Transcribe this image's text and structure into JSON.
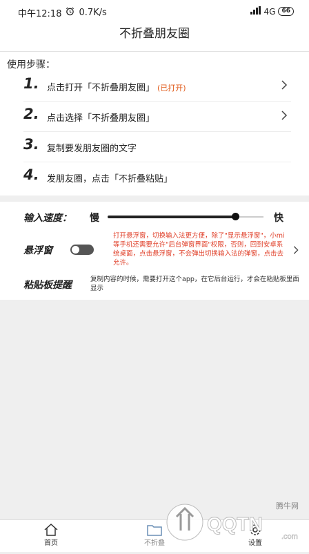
{
  "status_bar": {
    "time": "中午12:18",
    "alarm_icon": "alarm-clock-icon",
    "speed": "0.7K/s",
    "network": "4G",
    "battery": "66"
  },
  "header": {
    "title": "不折叠朋友圈"
  },
  "steps": {
    "heading": "使用步骤：",
    "items": [
      {
        "num": "1.",
        "text": "点击打开「不折叠朋友圈」",
        "tag": "(已打开)",
        "chevron": true
      },
      {
        "num": "2.",
        "text": "点击选择「不折叠朋友圈」",
        "tag": "",
        "chevron": true
      },
      {
        "num": "3.",
        "text": "复制要发朋友圈的文字",
        "tag": "",
        "chevron": false
      },
      {
        "num": "4.",
        "text": "发朋友圈，点击「不折叠粘贴」",
        "tag": "",
        "chevron": false
      }
    ]
  },
  "settings": {
    "speed_label": "输入速度：",
    "slow_label": "慢",
    "fast_label": "快",
    "speed_level": 0.82,
    "float_label": "悬浮窗",
    "float_enabled": false,
    "float_note": "打开悬浮窗，切换输入法更方便，除了\"显示悬浮窗\"，小mi等手机还需要允许\"后台弹窗界面\"权限，否则，回到安卓系统桌面，点击悬浮窗，不会弹出切换输入法的弹窗，点击去允许。",
    "clip_label": "粘贴板提醒",
    "clip_note": "复制内容的时候，需要打开这个app，在它后台运行，才会在粘贴板里面显示"
  },
  "tabs": [
    {
      "label": "首页",
      "icon": "home-icon"
    },
    {
      "label": "不折叠",
      "icon": "folder-icon"
    },
    {
      "label": "设置",
      "icon": "gear-icon"
    }
  ],
  "watermark": {
    "text": "QQTN.com",
    "site": "腾牛网"
  },
  "colors": {
    "accent_red": "#e0402a",
    "tag_orange": "#e05a1a"
  }
}
